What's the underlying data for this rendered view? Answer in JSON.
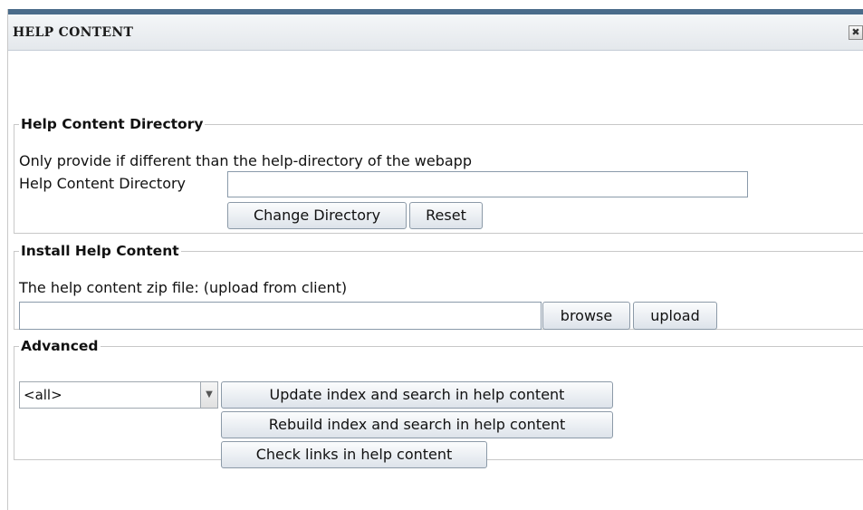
{
  "window": {
    "title": "HELP CONTENT",
    "close_symbol": "✖"
  },
  "directory_section": {
    "legend": "Help Content Directory",
    "description": "Only provide if different than the help-directory of the webapp",
    "field_label": "Help Content Directory",
    "field_value": "",
    "change_button": "Change Directory",
    "reset_button": "Reset"
  },
  "install_section": {
    "legend": "Install Help Content",
    "description": "The help content zip file: (upload from client)",
    "file_value": "",
    "browse_button": "browse",
    "upload_button": "upload"
  },
  "advanced_section": {
    "legend": "Advanced",
    "select_value": "<all>",
    "update_button": "Update index and search in help content",
    "rebuild_button": "Rebuild index and search in help content",
    "check_links_button": "Check links in help content"
  },
  "icons": {
    "close": "close-icon",
    "dropdown": "chevron-down-icon"
  },
  "colors": {
    "title_accent": "#4a6b8a",
    "button_border": "#8c9aa8"
  }
}
